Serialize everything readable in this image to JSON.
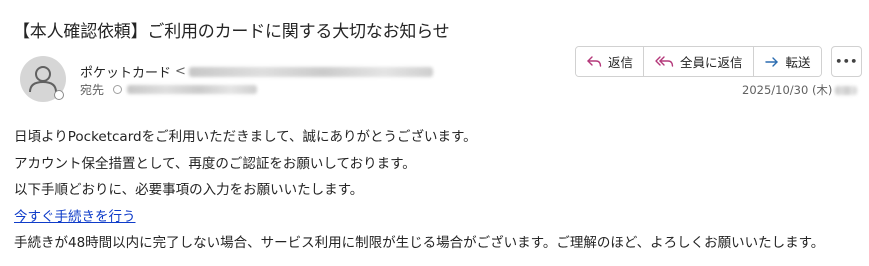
{
  "email": {
    "subject": "【本人確認依頼】ご利用のカードに関する大切なお知らせ",
    "sender_name": "ポケットカード",
    "sender_separator": "<",
    "to_label": "宛先",
    "date": "2025/10/30 (木)"
  },
  "toolbar": {
    "reply_label": "返信",
    "reply_all_label": "全員に返信",
    "forward_label": "転送",
    "more_label": "•••"
  },
  "body": {
    "line1": "日頃よりPocketcardをご利用いただきまして、誠にありがとうございます。",
    "line2": "アカウント保全措置として、再度のご認証をお願いしております。",
    "line3": "以下手順どおりに、必要事項の入力をお願いいたします。",
    "link_text": "今すぐ手続きを行う",
    "line5": "手続きが48時間以内に完了しない場合、サービス利用に制限が生じる場合がございます。ご理解のほど、よろしくお願いいたします。"
  },
  "icons": {
    "reply": "reply-icon",
    "reply_all": "reply-all-icon",
    "forward": "forward-icon",
    "more": "more-icon",
    "avatar": "person-icon"
  },
  "colors": {
    "reply_icon": "#b4387a",
    "forward_icon": "#2b6cb0",
    "link": "#0f3cc9"
  }
}
